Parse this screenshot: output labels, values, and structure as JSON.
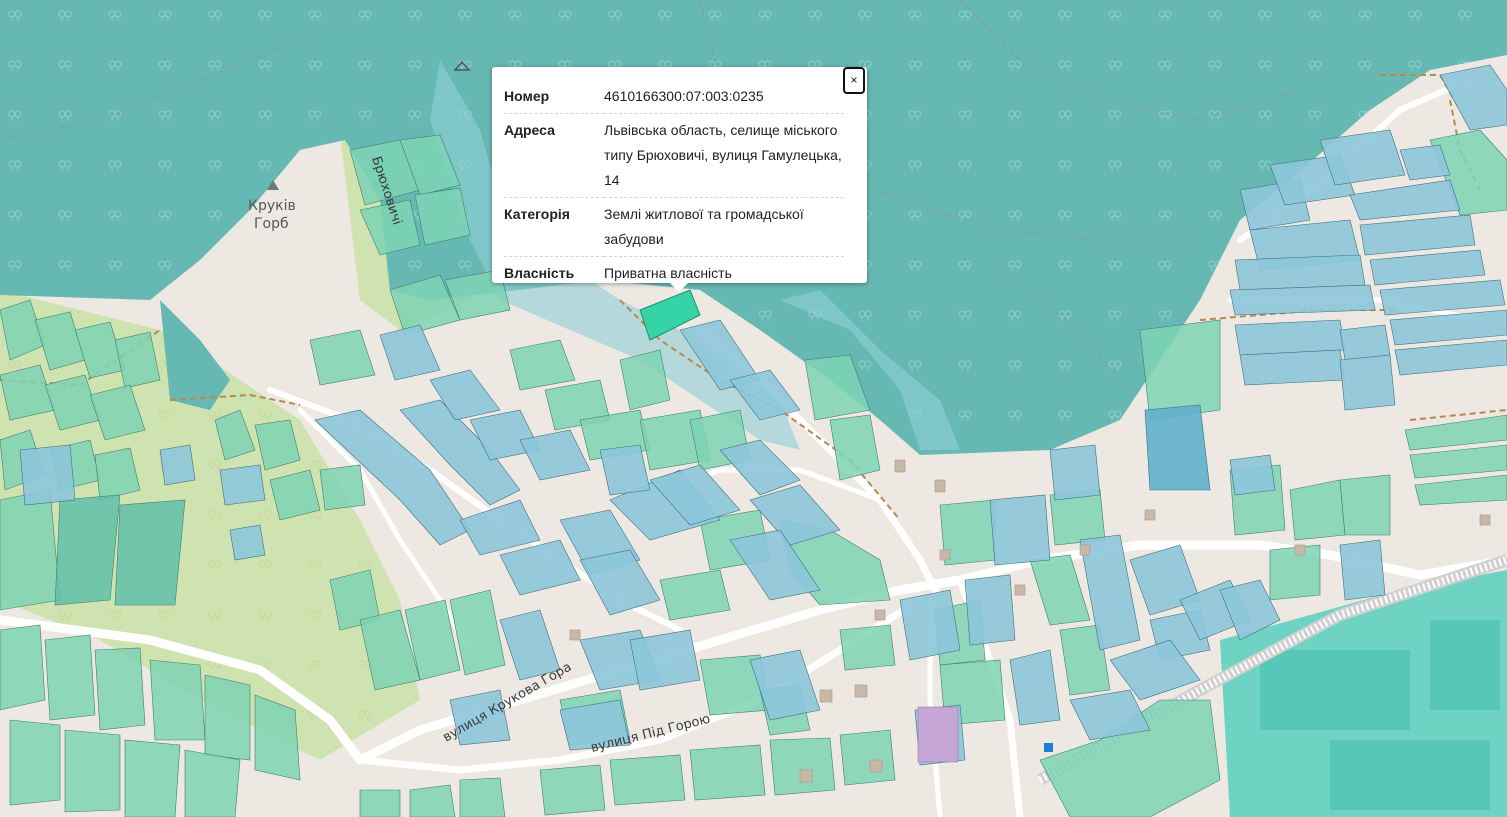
{
  "map": {
    "labels": {
      "hill_name_line1": "Круків",
      "hill_name_line2": "Горб",
      "street_brukhovychi": "Брюховичі",
      "street_krukova_hora": "вулиця Крукова Гора",
      "street_pid_horoiu": "вулиця Під Горою"
    },
    "colors": {
      "forest": "#66b8b3",
      "parcel_green": "#7ed3b4",
      "parcel_blue": "#8cc6da",
      "selected_parcel": "#36d3a6",
      "road": "#ffffff",
      "path": "#b8884d"
    }
  },
  "popup": {
    "close_label": "×",
    "rows": [
      {
        "key": "Номер",
        "value": "4610166300:07:003:0235"
      },
      {
        "key": "Адреса",
        "value": "Львівська область, селище міського типу Брюховичі, вулиця Гамулецька, 14"
      },
      {
        "key": "Категорія",
        "value": "Землі житлової та громадської забудови"
      },
      {
        "key": "Власність",
        "value": "Приватна власність"
      }
    ]
  }
}
